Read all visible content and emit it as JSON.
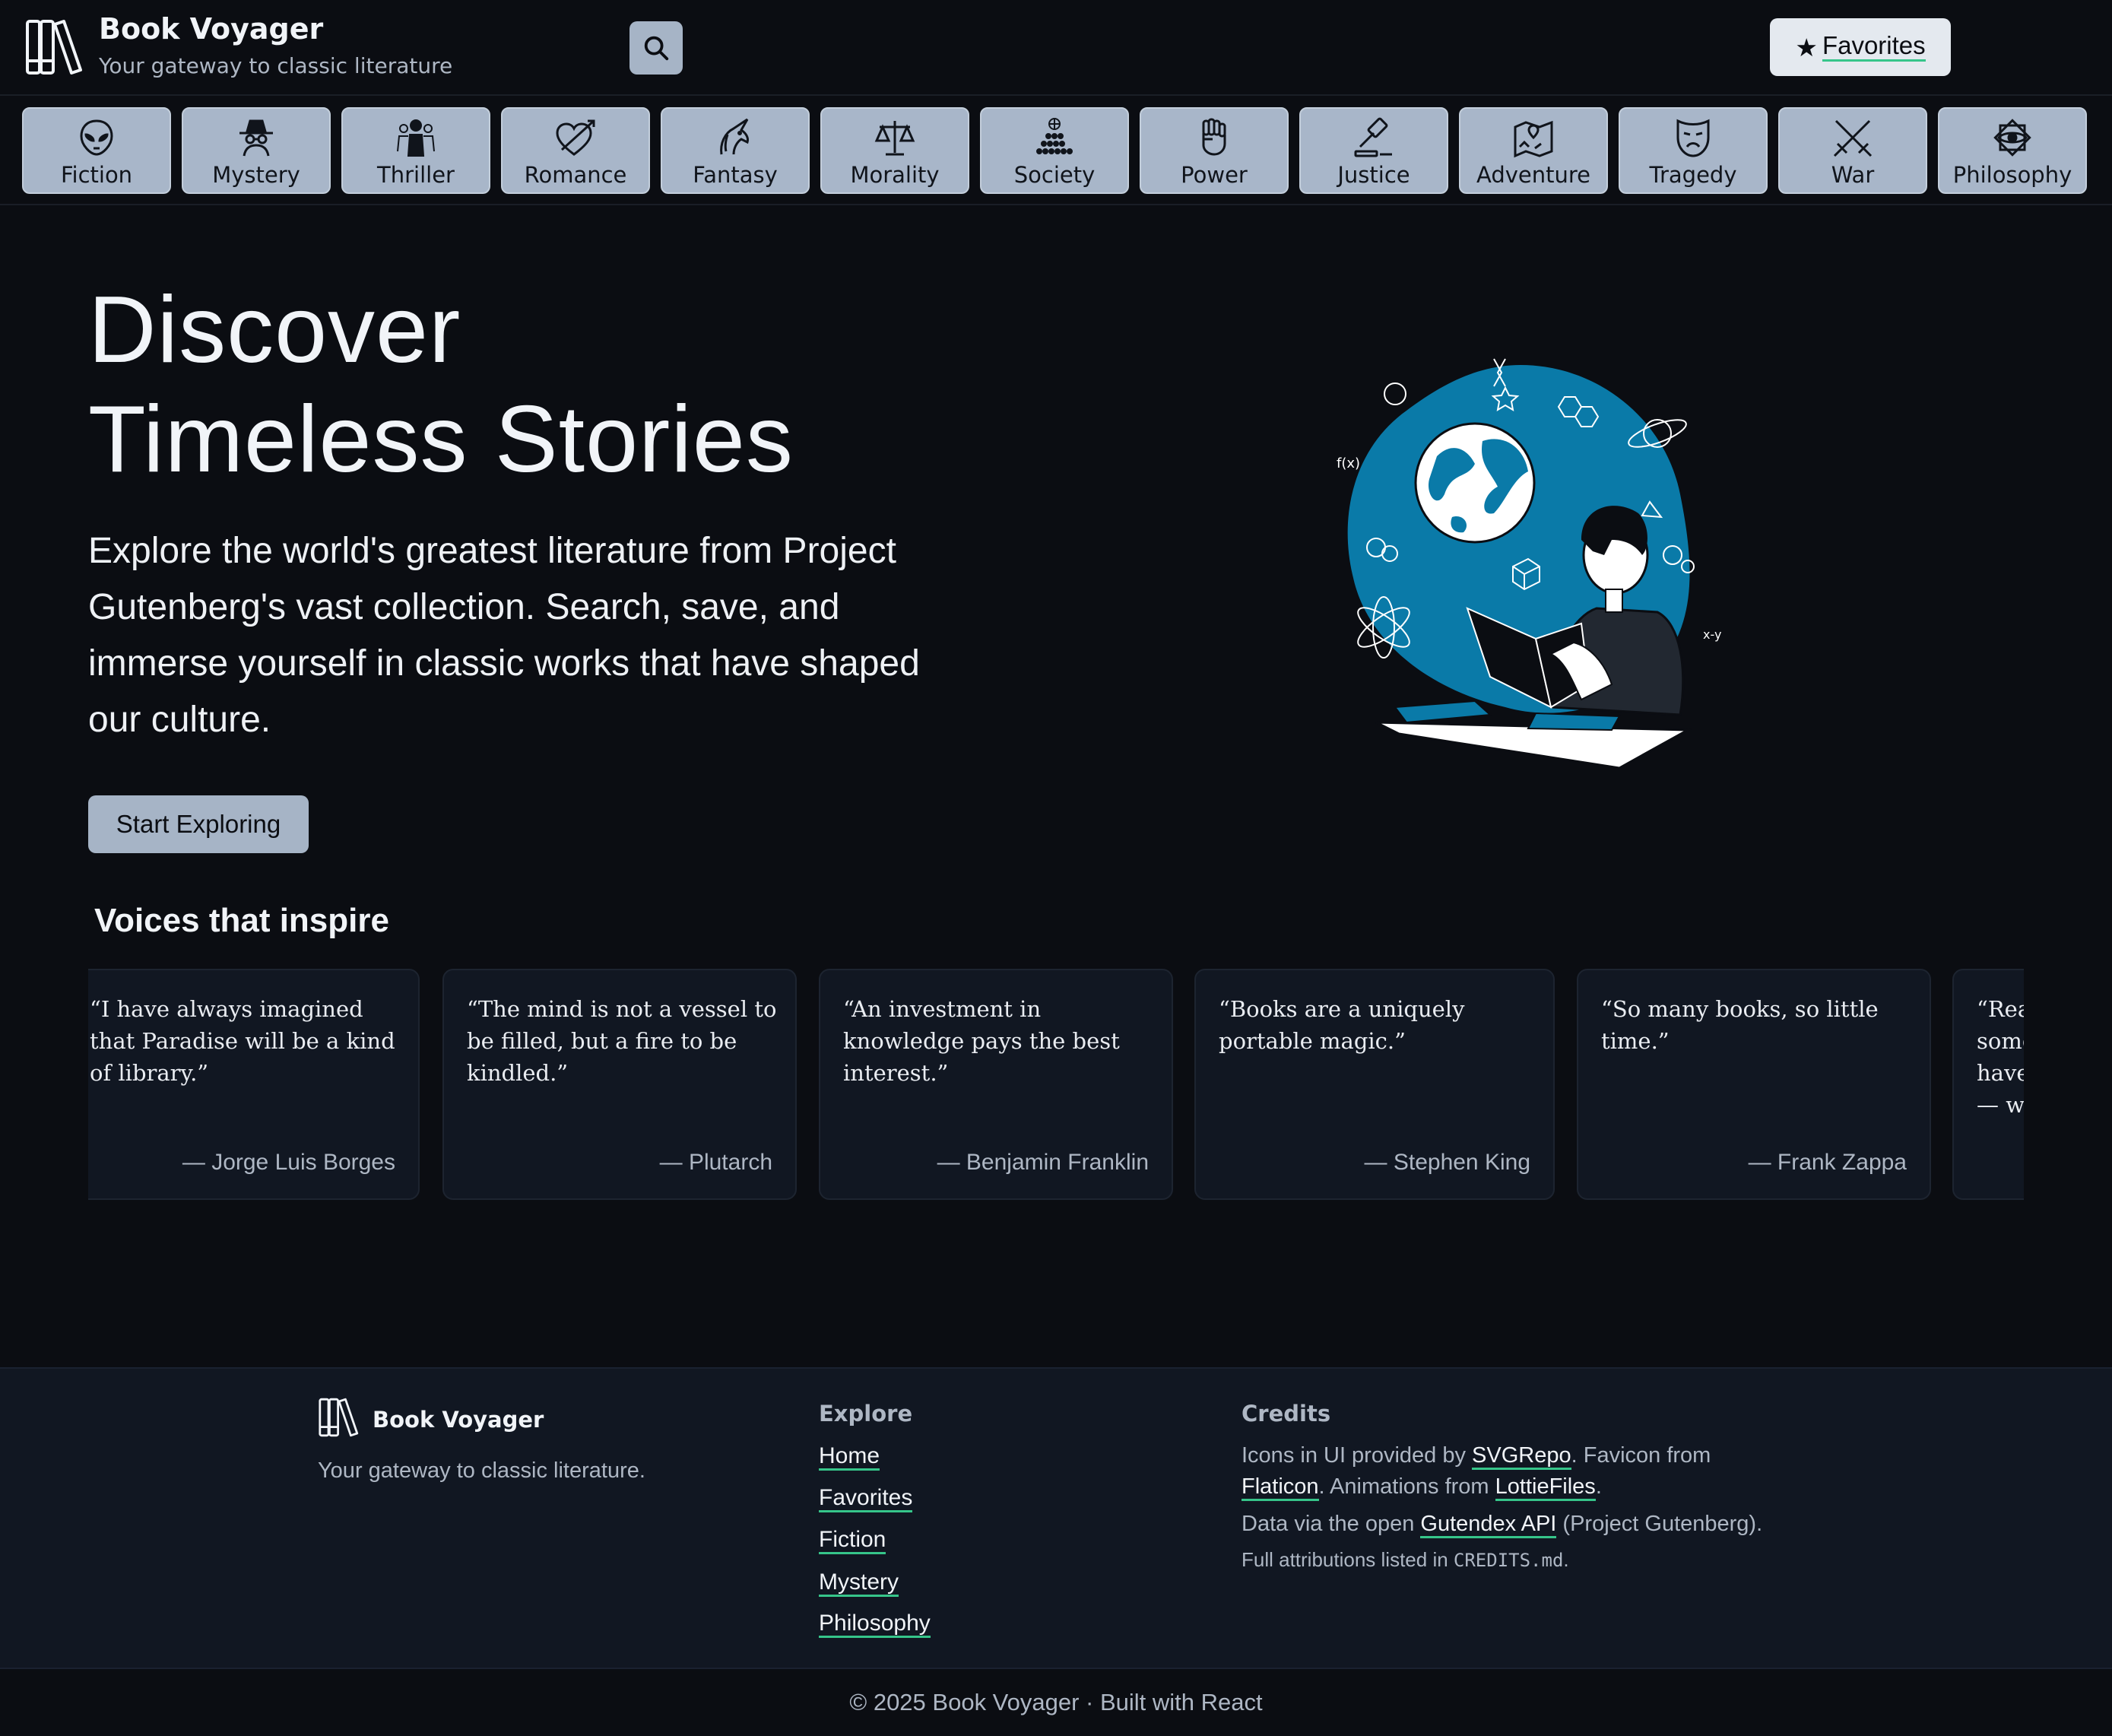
{
  "header": {
    "title": "Book Voyager",
    "tagline": "Your gateway to classic literature",
    "search_icon": "search-icon",
    "favorites_label": "Favorites",
    "favorites_star": "★"
  },
  "genres": [
    {
      "label": "Fiction",
      "icon": "alien-icon"
    },
    {
      "label": "Mystery",
      "icon": "detective-icon"
    },
    {
      "label": "Thriller",
      "icon": "group-icon"
    },
    {
      "label": "Romance",
      "icon": "heart-arrow-icon"
    },
    {
      "label": "Fantasy",
      "icon": "unicorn-icon"
    },
    {
      "label": "Morality",
      "icon": "scales-icon"
    },
    {
      "label": "Society",
      "icon": "crowd-globe-icon"
    },
    {
      "label": "Power",
      "icon": "fist-icon"
    },
    {
      "label": "Justice",
      "icon": "gavel-icon"
    },
    {
      "label": "Adventure",
      "icon": "map-icon"
    },
    {
      "label": "Tragedy",
      "icon": "sad-mask-icon"
    },
    {
      "label": "War",
      "icon": "crossed-swords-icon"
    },
    {
      "label": "Philosophy",
      "icon": "eye-icon"
    }
  ],
  "hero": {
    "title_line1": "Discover",
    "title_line2": "Timeless Stories",
    "description": "Explore the world's greatest literature from Project Gutenberg's vast collection. Search, save, and immerse yourself in classic works that have shaped our culture.",
    "cta_label": "Start Exploring",
    "illustration": "person-reading-illustration"
  },
  "voices": {
    "title": "Voices that inspire",
    "quotes": [
      {
        "text": "“I have always imagined that Paradise will be a kind of library.”",
        "author": "— Jorge Luis Borges"
      },
      {
        "text": "“The mind is not a vessel to be filled, but a fire to be kindled.”",
        "author": "— Plutarch"
      },
      {
        "text": "“An investment in knowledge pays the best interest.”",
        "author": "— Benjamin Franklin"
      },
      {
        "text": "“Books are a uniquely portable magic.”",
        "author": "— Stephen King"
      },
      {
        "text": "“So many books, so little time.”",
        "author": "— Frank Zappa"
      },
      {
        "text": "“Reading gives us someplace to go when we have to stay where we are — who we are and ordinary",
        "author": ""
      }
    ]
  },
  "footer": {
    "brand_name": "Book Voyager",
    "tagline": "Your gateway to classic literature.",
    "explore_heading": "Explore",
    "explore_links": [
      "Home",
      "Favorites",
      "Fiction",
      "Mystery",
      "Philosophy"
    ],
    "credits_heading": "Credits",
    "credits": {
      "l1_pre": "Icons in UI provided by ",
      "l1_link": "SVGRepo",
      "l1_post": ". Favicon from",
      "l2_link1": "Flaticon",
      "l2_mid": ". Animations from ",
      "l2_link2": "LottieFiles",
      "l2_post": ".",
      "l3_pre": "Data via the open ",
      "l3_link": "Gutendex API",
      "l3_post": " (Project Gutenberg).",
      "l4_pre": "Full attributions listed in ",
      "l4_code": "CREDITS.md",
      "l4_post": "."
    },
    "copyright": "© 2025 Book Voyager · Built with React"
  },
  "colors": {
    "background": "#0b0d12",
    "button": "#a6b4c6",
    "accent_underline": "#36c58a",
    "card": "#111722",
    "illustration_blue": "#0a7aa8"
  }
}
